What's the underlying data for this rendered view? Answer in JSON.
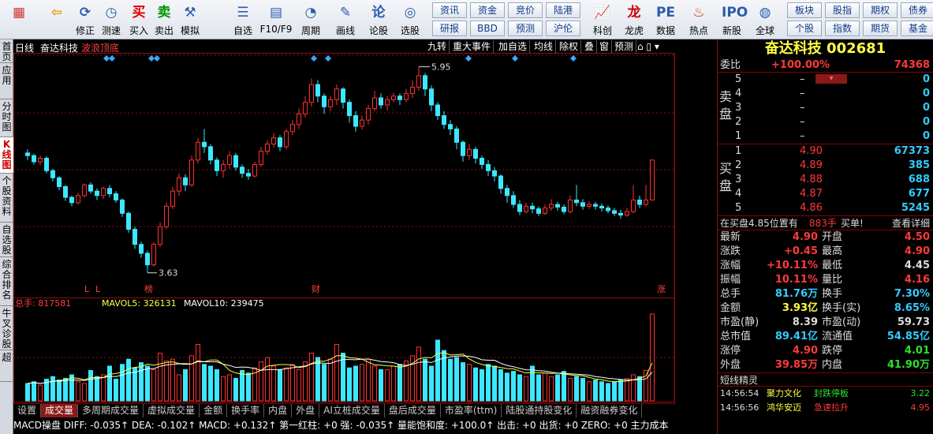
{
  "toolbar": {
    "items": [
      {
        "label": "",
        "icon": "logo-icon"
      },
      {
        "label": "",
        "icon": "back-icon"
      },
      {
        "label": "修正",
        "icon": "correction-icon"
      },
      {
        "label": "测速",
        "icon": "speed-test-icon"
      },
      {
        "label": "买入",
        "icon": "buy-icon",
        "glyph": "买"
      },
      {
        "label": "卖出",
        "icon": "sell-icon",
        "glyph": "卖"
      },
      {
        "label": "模拟",
        "icon": "simulation-icon"
      },
      {
        "label": "自选",
        "icon": "watchlist-icon"
      },
      {
        "label": "F10/F9",
        "icon": "f10-icon"
      },
      {
        "label": "周期",
        "icon": "period-icon"
      },
      {
        "label": "画线",
        "icon": "draw-line-icon"
      },
      {
        "label": "论股",
        "icon": "discuss-icon"
      },
      {
        "label": "选股",
        "icon": "stock-pick-icon"
      },
      {
        "label": "科创",
        "icon": "star-market-icon"
      },
      {
        "label": "龙虎",
        "icon": "dragon-tiger-icon"
      },
      {
        "label": "数据",
        "icon": "data-icon"
      },
      {
        "label": "热点",
        "icon": "hotspot-icon"
      },
      {
        "label": "新股",
        "icon": "ipo-icon"
      },
      {
        "label": "全球",
        "icon": "globe-icon"
      }
    ],
    "small_buttons": [
      [
        "资讯",
        "资金",
        "竞价",
        "陆港"
      ],
      [
        "研报",
        "BBD",
        "预测",
        "沪伦"
      ],
      [
        "板块",
        "股指",
        "期权",
        "债券"
      ],
      [
        "个股",
        "指数",
        "期货",
        "基金"
      ]
    ]
  },
  "side_tabs": [
    "首页",
    "应用",
    "分时图",
    "K线图",
    "个股资料",
    "自选股",
    "综合排名",
    "牛叉诊股",
    "超"
  ],
  "chart_header": {
    "period": "日线",
    "stock": "奋达科技",
    "indicator": "波浪顶底",
    "buttons": [
      "九转",
      "重大事件",
      "加自选",
      "均线",
      "除权",
      "叠",
      "窗",
      "预测"
    ]
  },
  "chart_data": {
    "type": "candlestick",
    "ylim": [
      3.45,
      6.08
    ],
    "y_ticks": [
      "6.08",
      "5.43",
      "4.79",
      "4.15"
    ],
    "annotations": {
      "high": "5.95",
      "low": "3.63"
    },
    "bottom_marks": [
      "L",
      "L",
      "榜",
      "财",
      "涨"
    ],
    "candles": [
      [
        4.98,
        4.95,
        5.02,
        4.9
      ],
      [
        4.95,
        4.88,
        4.97,
        4.85
      ],
      [
        4.88,
        4.92,
        4.95,
        4.84
      ],
      [
        4.92,
        4.78,
        4.94,
        4.75
      ],
      [
        4.78,
        4.7,
        4.8,
        4.66
      ],
      [
        4.7,
        4.6,
        4.72,
        4.56
      ],
      [
        4.6,
        4.48,
        4.62,
        4.44
      ],
      [
        4.48,
        4.42,
        4.5,
        4.38
      ],
      [
        4.42,
        4.5,
        4.53,
        4.4
      ],
      [
        4.5,
        4.62,
        4.64,
        4.48
      ],
      [
        4.62,
        4.55,
        4.65,
        4.52
      ],
      [
        4.55,
        4.5,
        4.58,
        4.45
      ],
      [
        4.5,
        4.58,
        4.6,
        4.46
      ],
      [
        4.58,
        4.52,
        4.62,
        4.48
      ],
      [
        4.52,
        4.45,
        4.55,
        4.42
      ],
      [
        4.45,
        4.3,
        4.47,
        4.26
      ],
      [
        4.3,
        4.12,
        4.32,
        4.08
      ],
      [
        4.12,
        3.95,
        4.15,
        3.9
      ],
      [
        3.95,
        3.85,
        3.98,
        3.8
      ],
      [
        3.85,
        3.72,
        3.88,
        3.63
      ],
      [
        3.72,
        3.95,
        3.98,
        3.7
      ],
      [
        3.95,
        4.15,
        4.2,
        3.92
      ],
      [
        4.15,
        4.38,
        4.42,
        4.12
      ],
      [
        4.38,
        4.55,
        4.6,
        4.35
      ],
      [
        4.55,
        4.7,
        4.75,
        4.5
      ],
      [
        4.7,
        4.62,
        4.74,
        4.55
      ],
      [
        4.62,
        4.9,
        4.95,
        4.6
      ],
      [
        4.9,
        5.1,
        5.15,
        4.86
      ],
      [
        5.1,
        5.05,
        5.25,
        4.98
      ],
      [
        5.05,
        4.9,
        5.08,
        4.85
      ],
      [
        4.9,
        4.78,
        4.93,
        4.72
      ],
      [
        4.78,
        4.85,
        4.9,
        4.7
      ],
      [
        4.85,
        4.95,
        5.0,
        4.8
      ],
      [
        4.95,
        4.82,
        4.98,
        4.78
      ],
      [
        4.82,
        4.75,
        4.85,
        4.7
      ],
      [
        4.75,
        4.72,
        4.8,
        4.68
      ],
      [
        4.72,
        4.85,
        4.88,
        4.7
      ],
      [
        4.85,
        5.0,
        5.05,
        4.82
      ],
      [
        5.0,
        5.08,
        5.12,
        4.96
      ],
      [
        5.08,
        5.15,
        5.2,
        5.04
      ],
      [
        5.15,
        5.05,
        5.18,
        5.0
      ],
      [
        5.05,
        5.22,
        5.25,
        5.02
      ],
      [
        5.22,
        5.3,
        5.35,
        5.18
      ],
      [
        5.3,
        5.42,
        5.48,
        5.25
      ],
      [
        5.42,
        5.55,
        5.62,
        5.38
      ],
      [
        5.55,
        5.75,
        5.82,
        5.5
      ],
      [
        5.75,
        5.62,
        5.8,
        5.55
      ],
      [
        5.62,
        5.5,
        5.65,
        5.42
      ],
      [
        5.5,
        5.58,
        5.62,
        5.45
      ],
      [
        5.58,
        5.7,
        5.75,
        5.52
      ],
      [
        5.7,
        5.55,
        5.72,
        5.48
      ],
      [
        5.55,
        5.4,
        5.58,
        5.32
      ],
      [
        5.4,
        5.28,
        5.45,
        5.22
      ],
      [
        5.28,
        5.35,
        5.4,
        5.24
      ],
      [
        5.35,
        5.48,
        5.52,
        5.3
      ],
      [
        5.48,
        5.6,
        5.68,
        5.45
      ],
      [
        5.6,
        5.52,
        5.65,
        5.48
      ],
      [
        5.52,
        5.58,
        5.62,
        5.46
      ],
      [
        5.58,
        5.62,
        5.66,
        5.55
      ],
      [
        5.62,
        5.58,
        5.65,
        5.52
      ],
      [
        5.58,
        5.65,
        5.7,
        5.55
      ],
      [
        5.65,
        5.72,
        5.8,
        5.6
      ],
      [
        5.72,
        5.85,
        5.95,
        5.68
      ],
      [
        5.85,
        5.7,
        5.88,
        5.62
      ],
      [
        5.7,
        5.52,
        5.74,
        5.45
      ],
      [
        5.52,
        5.4,
        5.55,
        5.35
      ],
      [
        5.4,
        5.3,
        5.45,
        5.25
      ],
      [
        5.3,
        5.25,
        5.35,
        5.18
      ],
      [
        5.25,
        5.1,
        5.28,
        5.02
      ],
      [
        5.1,
        4.95,
        5.12,
        4.88
      ],
      [
        4.95,
        5.02,
        5.08,
        4.9
      ],
      [
        5.02,
        4.92,
        5.05,
        4.86
      ],
      [
        4.92,
        4.85,
        4.95,
        4.8
      ],
      [
        4.85,
        4.78,
        4.9,
        4.72
      ],
      [
        4.78,
        4.72,
        4.82,
        4.66
      ],
      [
        4.72,
        4.58,
        4.74,
        4.52
      ],
      [
        4.58,
        4.5,
        4.62,
        4.42
      ],
      [
        4.5,
        4.4,
        4.55,
        4.36
      ],
      [
        4.4,
        4.32,
        4.45,
        4.28
      ],
      [
        4.32,
        4.38,
        4.42,
        4.3
      ],
      [
        4.38,
        4.35,
        4.42,
        4.3
      ],
      [
        4.35,
        4.3,
        4.38,
        4.27
      ],
      [
        4.3,
        4.36,
        4.4,
        4.28
      ],
      [
        4.36,
        4.4,
        4.46,
        4.33
      ],
      [
        4.4,
        4.37,
        4.43,
        4.33
      ],
      [
        4.37,
        4.32,
        4.4,
        4.29
      ],
      [
        4.32,
        4.45,
        4.5,
        4.3
      ],
      [
        4.45,
        4.42,
        4.62,
        4.38
      ],
      [
        4.42,
        4.38,
        4.46,
        4.34
      ],
      [
        4.38,
        4.4,
        4.44,
        4.35
      ],
      [
        4.4,
        4.38,
        4.43,
        4.34
      ],
      [
        4.38,
        4.36,
        4.41,
        4.32
      ],
      [
        4.36,
        4.33,
        4.39,
        4.3
      ],
      [
        4.33,
        4.3,
        4.36,
        4.27
      ],
      [
        4.3,
        4.28,
        4.34,
        4.24
      ],
      [
        4.28,
        4.32,
        4.36,
        4.26
      ],
      [
        4.32,
        4.45,
        4.62,
        4.3
      ],
      [
        4.45,
        4.4,
        4.5,
        4.36
      ],
      [
        4.4,
        4.45,
        4.62,
        4.38
      ],
      [
        4.45,
        4.9,
        4.9,
        4.45
      ]
    ],
    "volume": {
      "label": "总手: 817581",
      "mavol5": "MAVOL5: 326131",
      "mavol10": "MAVOL10: 239475",
      "y_ticks": [
        "81758",
        "40879"
      ],
      "unit": "X10",
      "max": 817581
    }
  },
  "bottom_tabs": [
    "设置",
    "成交量",
    "多周期成交量",
    "虚拟成交量",
    "金额",
    "换手率",
    "内盘",
    "外盘",
    "AI立桩成交量",
    "盘后成交量",
    "市盈率(ttm)",
    "陆股通持股变化",
    "融资融券变化"
  ],
  "macd_line": "MACD操盘  DIFF: -0.035↑  DEA: -0.102↑  MACD: +0.132↑  第一红柱: +0  强: -0.035↑  量能饱和度: +100.0↑  出击: +0  出货: +0  ZERO: +0  主力成本",
  "quote": {
    "title": "奋达科技 002681",
    "weibi_label": "委比",
    "weibi_value": "+100.00%",
    "weibi_count": "74368",
    "sell_label": "卖盘",
    "buy_label": "买盘",
    "sell": [
      {
        "n": "5",
        "p": "–",
        "v": "0"
      },
      {
        "n": "4",
        "p": "–",
        "v": "0"
      },
      {
        "n": "3",
        "p": "–",
        "v": "0"
      },
      {
        "n": "2",
        "p": "–",
        "v": "0"
      },
      {
        "n": "1",
        "p": "–",
        "v": "0"
      }
    ],
    "buy": [
      {
        "n": "1",
        "p": "4.90",
        "v": "67373"
      },
      {
        "n": "2",
        "p": "4.89",
        "v": "385"
      },
      {
        "n": "3",
        "p": "4.88",
        "v": "688"
      },
      {
        "n": "4",
        "p": "4.87",
        "v": "677"
      },
      {
        "n": "5",
        "p": "4.86",
        "v": "5245"
      }
    ],
    "notice_left": "在买盘4.85位置有",
    "notice_hand": "883手",
    "notice_buy": "买单!",
    "notice_link": "查看详细",
    "stats": [
      [
        "最新",
        "4.90",
        "开盘",
        "4.50"
      ],
      [
        "涨跌",
        "+0.45",
        "最高",
        "4.90"
      ],
      [
        "涨幅",
        "+10.11%",
        "最低",
        "4.45"
      ],
      [
        "振幅",
        "10.11%",
        "量比",
        "4.16"
      ],
      [
        "总手",
        "81.76万",
        "换手",
        "7.30%"
      ],
      [
        "金额",
        "3.93亿",
        "换手(实)",
        "8.65%"
      ],
      [
        "市盈(静)",
        "8.39",
        "市盈(动)",
        "59.73"
      ],
      [
        "总市值",
        "89.41亿",
        "流通值",
        "54.85亿"
      ],
      [
        "涨停",
        "4.90",
        "跌停",
        "4.01"
      ],
      [
        "外盘",
        "39.85万",
        "内盘",
        "41.90万"
      ]
    ],
    "short_title": "短线精灵",
    "short_items": [
      {
        "time": "14:56:54",
        "name": "聚力文化",
        "event": "封跌停板",
        "val": "3.22"
      },
      {
        "time": "14:56:56",
        "name": "鸿华安迈",
        "event": "急速拉升",
        "val": "4.95"
      }
    ]
  }
}
